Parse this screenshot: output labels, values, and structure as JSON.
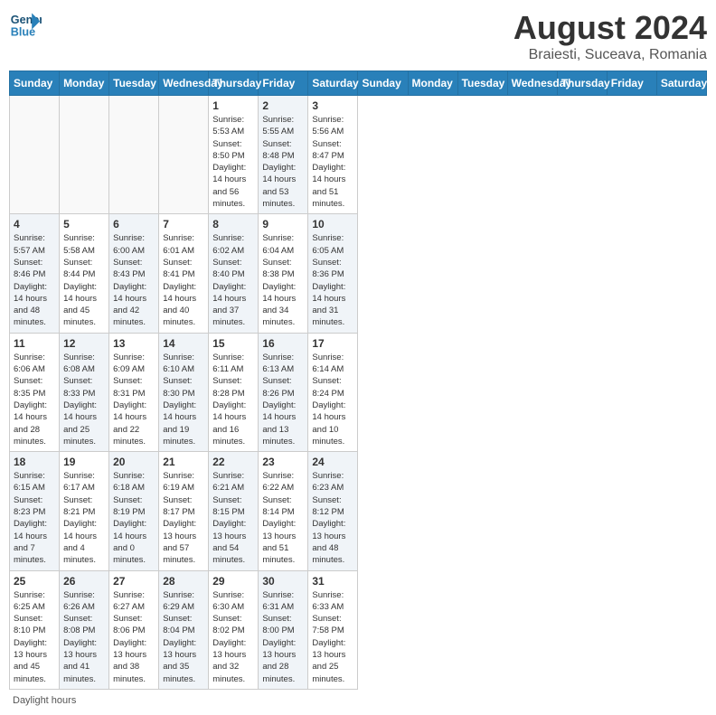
{
  "app": {
    "logo_line1": "General",
    "logo_line2": "Blue",
    "title": "August 2024",
    "subtitle": "Braiesti, Suceava, Romania"
  },
  "calendar": {
    "headers": [
      "Sunday",
      "Monday",
      "Tuesday",
      "Wednesday",
      "Thursday",
      "Friday",
      "Saturday"
    ],
    "weeks": [
      [
        {
          "day": "",
          "info": "",
          "empty": true
        },
        {
          "day": "",
          "info": "",
          "empty": true
        },
        {
          "day": "",
          "info": "",
          "empty": true
        },
        {
          "day": "",
          "info": "",
          "empty": true
        },
        {
          "day": "1",
          "info": "Sunrise: 5:53 AM\nSunset: 8:50 PM\nDaylight: 14 hours\nand 56 minutes.",
          "shaded": false
        },
        {
          "day": "2",
          "info": "Sunrise: 5:55 AM\nSunset: 8:48 PM\nDaylight: 14 hours\nand 53 minutes.",
          "shaded": true
        },
        {
          "day": "3",
          "info": "Sunrise: 5:56 AM\nSunset: 8:47 PM\nDaylight: 14 hours\nand 51 minutes.",
          "shaded": false
        }
      ],
      [
        {
          "day": "4",
          "info": "Sunrise: 5:57 AM\nSunset: 8:46 PM\nDaylight: 14 hours\nand 48 minutes.",
          "shaded": true
        },
        {
          "day": "5",
          "info": "Sunrise: 5:58 AM\nSunset: 8:44 PM\nDaylight: 14 hours\nand 45 minutes.",
          "shaded": false
        },
        {
          "day": "6",
          "info": "Sunrise: 6:00 AM\nSunset: 8:43 PM\nDaylight: 14 hours\nand 42 minutes.",
          "shaded": true
        },
        {
          "day": "7",
          "info": "Sunrise: 6:01 AM\nSunset: 8:41 PM\nDaylight: 14 hours\nand 40 minutes.",
          "shaded": false
        },
        {
          "day": "8",
          "info": "Sunrise: 6:02 AM\nSunset: 8:40 PM\nDaylight: 14 hours\nand 37 minutes.",
          "shaded": true
        },
        {
          "day": "9",
          "info": "Sunrise: 6:04 AM\nSunset: 8:38 PM\nDaylight: 14 hours\nand 34 minutes.",
          "shaded": false
        },
        {
          "day": "10",
          "info": "Sunrise: 6:05 AM\nSunset: 8:36 PM\nDaylight: 14 hours\nand 31 minutes.",
          "shaded": true
        }
      ],
      [
        {
          "day": "11",
          "info": "Sunrise: 6:06 AM\nSunset: 8:35 PM\nDaylight: 14 hours\nand 28 minutes.",
          "shaded": false
        },
        {
          "day": "12",
          "info": "Sunrise: 6:08 AM\nSunset: 8:33 PM\nDaylight: 14 hours\nand 25 minutes.",
          "shaded": true
        },
        {
          "day": "13",
          "info": "Sunrise: 6:09 AM\nSunset: 8:31 PM\nDaylight: 14 hours\nand 22 minutes.",
          "shaded": false
        },
        {
          "day": "14",
          "info": "Sunrise: 6:10 AM\nSunset: 8:30 PM\nDaylight: 14 hours\nand 19 minutes.",
          "shaded": true
        },
        {
          "day": "15",
          "info": "Sunrise: 6:11 AM\nSunset: 8:28 PM\nDaylight: 14 hours\nand 16 minutes.",
          "shaded": false
        },
        {
          "day": "16",
          "info": "Sunrise: 6:13 AM\nSunset: 8:26 PM\nDaylight: 14 hours\nand 13 minutes.",
          "shaded": true
        },
        {
          "day": "17",
          "info": "Sunrise: 6:14 AM\nSunset: 8:24 PM\nDaylight: 14 hours\nand 10 minutes.",
          "shaded": false
        }
      ],
      [
        {
          "day": "18",
          "info": "Sunrise: 6:15 AM\nSunset: 8:23 PM\nDaylight: 14 hours\nand 7 minutes.",
          "shaded": true
        },
        {
          "day": "19",
          "info": "Sunrise: 6:17 AM\nSunset: 8:21 PM\nDaylight: 14 hours\nand 4 minutes.",
          "shaded": false
        },
        {
          "day": "20",
          "info": "Sunrise: 6:18 AM\nSunset: 8:19 PM\nDaylight: 14 hours\nand 0 minutes.",
          "shaded": true
        },
        {
          "day": "21",
          "info": "Sunrise: 6:19 AM\nSunset: 8:17 PM\nDaylight: 13 hours\nand 57 minutes.",
          "shaded": false
        },
        {
          "day": "22",
          "info": "Sunrise: 6:21 AM\nSunset: 8:15 PM\nDaylight: 13 hours\nand 54 minutes.",
          "shaded": true
        },
        {
          "day": "23",
          "info": "Sunrise: 6:22 AM\nSunset: 8:14 PM\nDaylight: 13 hours\nand 51 minutes.",
          "shaded": false
        },
        {
          "day": "24",
          "info": "Sunrise: 6:23 AM\nSunset: 8:12 PM\nDaylight: 13 hours\nand 48 minutes.",
          "shaded": true
        }
      ],
      [
        {
          "day": "25",
          "info": "Sunrise: 6:25 AM\nSunset: 8:10 PM\nDaylight: 13 hours\nand 45 minutes.",
          "shaded": false
        },
        {
          "day": "26",
          "info": "Sunrise: 6:26 AM\nSunset: 8:08 PM\nDaylight: 13 hours\nand 41 minutes.",
          "shaded": true
        },
        {
          "day": "27",
          "info": "Sunrise: 6:27 AM\nSunset: 8:06 PM\nDaylight: 13 hours\nand 38 minutes.",
          "shaded": false
        },
        {
          "day": "28",
          "info": "Sunrise: 6:29 AM\nSunset: 8:04 PM\nDaylight: 13 hours\nand 35 minutes.",
          "shaded": true
        },
        {
          "day": "29",
          "info": "Sunrise: 6:30 AM\nSunset: 8:02 PM\nDaylight: 13 hours\nand 32 minutes.",
          "shaded": false
        },
        {
          "day": "30",
          "info": "Sunrise: 6:31 AM\nSunset: 8:00 PM\nDaylight: 13 hours\nand 28 minutes.",
          "shaded": true
        },
        {
          "day": "31",
          "info": "Sunrise: 6:33 AM\nSunset: 7:58 PM\nDaylight: 13 hours\nand 25 minutes.",
          "shaded": false
        }
      ]
    ],
    "footer": "Daylight hours"
  }
}
